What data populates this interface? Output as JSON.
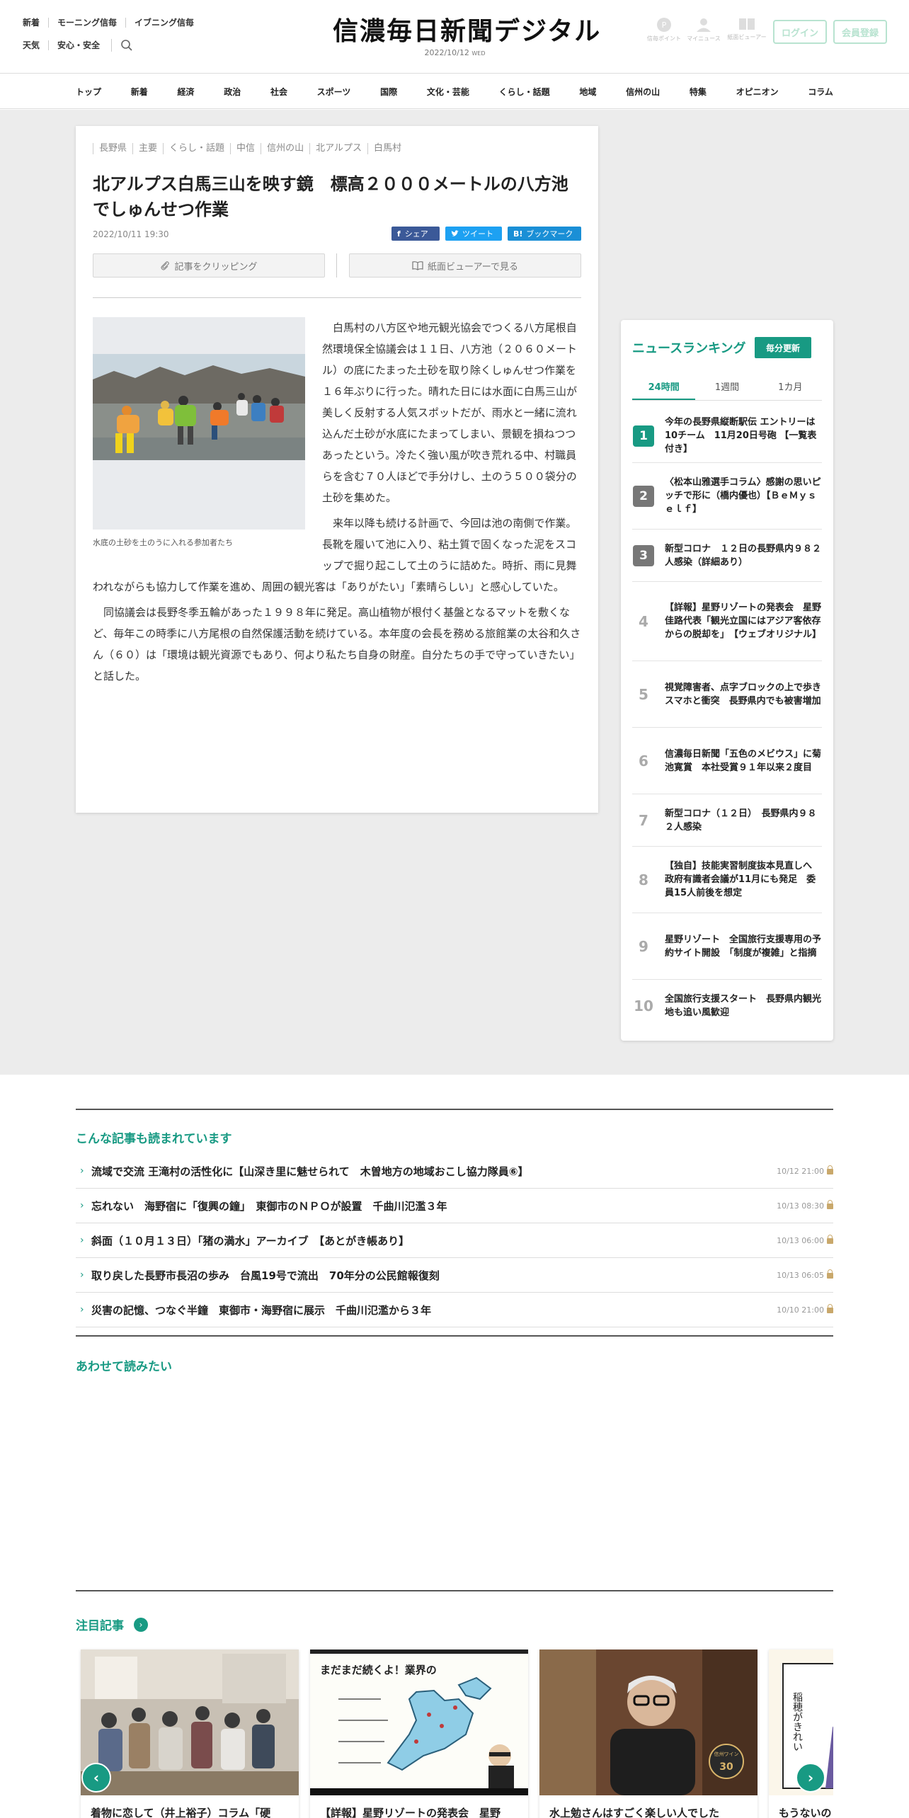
{
  "header": {
    "top_links_row1": [
      "新着",
      "モーニング信毎",
      "イブニング信毎"
    ],
    "top_links_row2": [
      "天気",
      "安心・安全"
    ],
    "logo": "信濃毎日新聞デジタル",
    "date": "2022/10/12",
    "weekday": "WED",
    "util": [
      {
        "icon": "point-icon",
        "label": "信毎ポイント"
      },
      {
        "icon": "user-icon",
        "label": "マイニュース"
      },
      {
        "icon": "paper-viewer-icon",
        "label": "紙面ビューアー"
      }
    ],
    "login": "ログイン",
    "register": "会員登録"
  },
  "nav": [
    "トップ",
    "新着",
    "経済",
    "政治",
    "社会",
    "スポーツ",
    "国際",
    "文化・芸能",
    "くらし・話題",
    "地域",
    "信州の山",
    "特集",
    "オピニオン",
    "コラム"
  ],
  "article": {
    "tags": [
      "長野県",
      "主要",
      "くらし・話題",
      "中信",
      "信州の山",
      "北アルプス",
      "白馬村"
    ],
    "headline": "北アルプス白馬三山を映す鏡　標高２０００メートルの八方池でしゅんせつ作業",
    "date": "2022/10/11 19:30",
    "share_fb": "シェア",
    "share_tw": "ツイート",
    "share_hb": "ブックマーク",
    "clip": "記事をクリッピング",
    "viewer": "紙面ビューアーで見る",
    "caption": "水底の土砂を土のうに入れる参加者たち",
    "paragraphs": [
      "白馬村の八方区や地元観光協会でつくる八方尾根自然環境保全協議会は１１日、八方池（２０６０メートル）の底にたまった土砂を取り除くしゅんせつ作業を１６年ぶりに行った。晴れた日には水面に白馬三山が美しく反射する人気スポットだが、雨水と一緒に流れ込んだ土砂が水底にたまってしまい、景観を損ねつつあったという。冷たく強い風が吹き荒れる中、村職員らを含む７０人ほどで手分けし、土のう５００袋分の土砂を集めた。",
      "来年以降も続ける計画で、今回は池の南側で作業。長靴を履いて池に入り、粘土質で固くなった泥をスコップで掘り起こして土のうに詰めた。時折、雨に見舞われながらも協力して作業を進め、周囲の観光客は「ありがたい」「素晴らしい」と感心していた。",
      "同協議会は長野冬季五輪があった１９９８年に発足。高山植物が根付く基盤となるマットを敷くなど、毎年この時季に八方尾根の自然保護活動を続けている。本年度の会長を務める旅館業の太谷和久さん（６０）は「環境は観光資源でもあり、何より私たち自身の財産。自分たちの手で守っていきたい」と話した。"
    ]
  },
  "ranking": {
    "title": "ニュースランキング",
    "badge": "毎分更新",
    "tabs": [
      "24時間",
      "1週間",
      "1カ月"
    ],
    "items": [
      {
        "rank": "1",
        "text": "今年の長野県縦断駅伝 エントリーは10チーム　11月20日号砲 【一覧表付き】"
      },
      {
        "rank": "2",
        "text": "〈松本山雅選手コラム〉感謝の思いピッチで形に（橋内優也）【ＢｅＭｙｓｅｌｆ】"
      },
      {
        "rank": "3",
        "text": "新型コロナ　１２日の長野県内９８２人感染（詳細あり）"
      },
      {
        "rank": "4",
        "text": "【詳報】星野リゾートの発表会　星野佳路代表「観光立国にはアジア客依存からの脱却を」　【ウェブオリジナル】"
      },
      {
        "rank": "5",
        "text": "視覚障害者、点字ブロックの上で歩きスマホと衝突　長野県内でも被害増加"
      },
      {
        "rank": "6",
        "text": "信濃毎日新聞「五色のメビウス」に菊池寛賞　本社受賞９１年以来２度目"
      },
      {
        "rank": "7",
        "text": "新型コロナ（１２日）　長野県内９８２人感染"
      },
      {
        "rank": "8",
        "text": "【独自】技能実習制度抜本見直しへ　政府有識者会議が11月にも発足　委員15人前後を想定"
      },
      {
        "rank": "9",
        "text": "星野リゾート　全国旅行支援専用の予約サイト開設　「制度が複雑」と指摘"
      },
      {
        "rank": "10",
        "text": "全国旅行支援スタート　長野県内観光地も追い風歓迎"
      }
    ]
  },
  "related": {
    "title": "こんな記事も読まれています",
    "items": [
      {
        "text": "流域で交流 王滝村の活性化に【山深き里に魅せられて　木曽地方の地域おこし協力隊員⑥】",
        "date": "10/12 21:00"
      },
      {
        "text": "忘れない　海野宿に「復興の鐘」　東御市のＮＰＯが設置　千曲川氾濫３年",
        "date": "10/13 08:30"
      },
      {
        "text": "斜面（１０月１３日）「猪の満水」アーカイブ　【あとがき帳あり】",
        "date": "10/13 06:00"
      },
      {
        "text": "取り戻した長野市長沼の歩み　台風19号で流出　70年分の公民館報復刻",
        "date": "10/13 06:05"
      },
      {
        "text": "災害の記憶、つなぐ半鐘　東御市・海野宿に展示　千曲川氾濫から３年",
        "date": "10/10 21:00"
      }
    ]
  },
  "also_read": {
    "title": "あわせて読みたい"
  },
  "featured": {
    "title": "注目記事",
    "cards": [
      {
        "title": "着物に恋して（井上裕子）コラム「硬"
      },
      {
        "title": "【詳報】星野リゾートの発表会　星野"
      },
      {
        "title": "水上勉さんはすごく楽しい人でした"
      },
      {
        "title": "もうないの"
      }
    ],
    "card2_banner": "まだまだ続くよ！業界の",
    "card3_badge_top": "信州ワイン",
    "card3_badge_num": "30",
    "card4_text": "稲穂がきれい"
  },
  "colors": {
    "accent": "#189a83",
    "rank_top": "#189a83",
    "rank_mid": "#777777",
    "band": "#ececec"
  }
}
